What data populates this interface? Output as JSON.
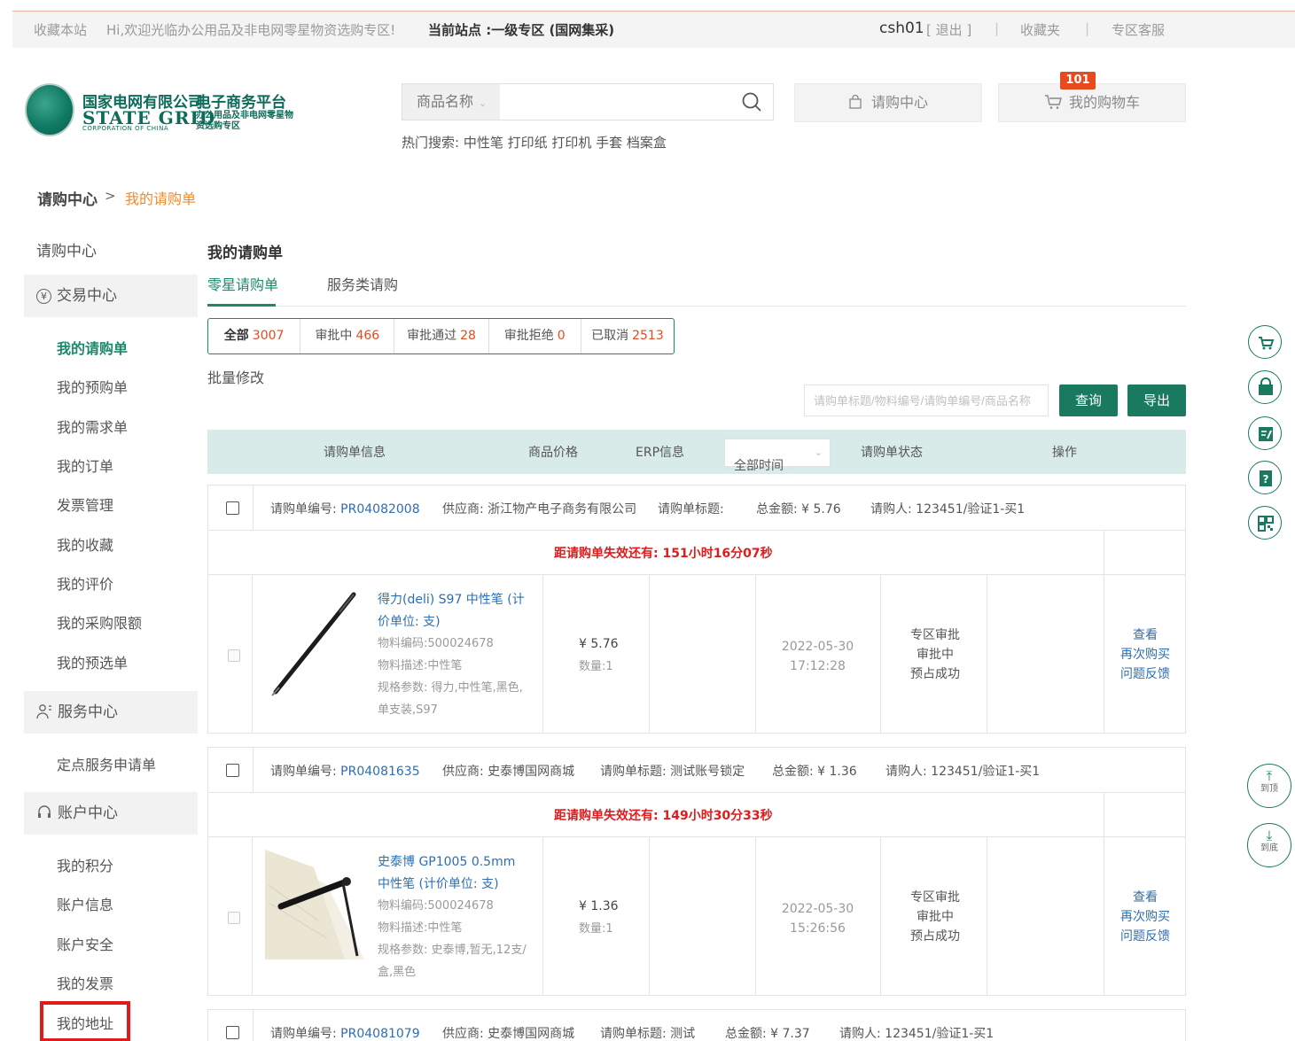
{
  "topbar": {
    "bookmark": "收藏本站",
    "welcome": "Hi,欢迎光临办公用品及非电网零星物资选购专区!",
    "current_site": "当前站点 :一级专区 (国网集采)",
    "username": "csh01",
    "logout": "[ 退出 ]",
    "favorites": "收藏夹",
    "service": "专区客服"
  },
  "logo": {
    "cn_name": "国家电网有限公司",
    "platform": "电子商务平台",
    "en_name": "STATE GRID",
    "en_sub": "CORPORATION OF CHINA",
    "sub": "办公用品及非电网零星物资选购专区"
  },
  "search": {
    "category": "商品名称",
    "value": "",
    "hot_label": "热门搜索:",
    "hot_terms": "中性笔 打印纸 打印机 手套 档案盒"
  },
  "header_buttons": {
    "purchase_center": "请购中心",
    "cart": "我的购物车",
    "cart_count": "101"
  },
  "breadcrumb": {
    "root": "请购中心",
    "sep": ">",
    "current": "我的请购单"
  },
  "sidebar": {
    "purchase_center": "请购中心",
    "trade_center": "交易中心",
    "trade_items": [
      "我的请购单",
      "我的预购单",
      "我的需求单",
      "我的订单",
      "发票管理",
      "我的收藏",
      "我的评价",
      "我的采购限额",
      "我的预选单"
    ],
    "service_center": "服务中心",
    "service_items": [
      "定点服务申请单"
    ],
    "account_center": "账户中心",
    "account_items": [
      "我的积分",
      "账户信息",
      "账户安全",
      "我的发票",
      "我的地址"
    ]
  },
  "main": {
    "title": "我的请购单",
    "tabs": [
      "零星请购单",
      "服务类请购"
    ],
    "status_tabs": [
      {
        "label": "全部",
        "count": "3007"
      },
      {
        "label": "审批中",
        "count": "466"
      },
      {
        "label": "审批通过",
        "count": "28"
      },
      {
        "label": "审批拒绝",
        "count": "0"
      },
      {
        "label": "已取消",
        "count": "2513"
      }
    ],
    "bulk_edit": "批量修改",
    "search_placeholder": "请购单标题/物料编号/请购单编号/商品名称",
    "query": "查询",
    "export": "导出"
  },
  "table_header": {
    "info": "请购单信息",
    "price": "商品价格",
    "erp": "ERP信息",
    "time_filter": "全部时间",
    "status": "请购单状态",
    "ops": "操作"
  },
  "orders": [
    {
      "no_label": "请购单编号:",
      "no": "PR04082008",
      "supplier": "供应商: 浙江物产电子商务有限公司",
      "title": "请购单标题:",
      "total": "总金额: ¥ 5.76",
      "buyer": "请购人: 123451/验证1-买1",
      "timer": "距请购单失效还有: 151小时16分07秒",
      "product": "得力(deli) S97 中性笔 (计价单位: 支)",
      "code": "物料编码:500024678",
      "desc": "物料描述:中性笔",
      "spec": "规格参数: 得力,中性笔,黑色,单支装,S97",
      "price": "¥ 5.76",
      "qty": "数量:1",
      "date": "2022-05-30",
      "time": "17:12:28",
      "status1": "专区审批",
      "status2": "审批中",
      "status3": "预占成功",
      "op1": "查看",
      "op2": "再次购买",
      "op3": "问题反馈"
    },
    {
      "no_label": "请购单编号:",
      "no": "PR04081635",
      "supplier": "供应商: 史泰博国网商城",
      "title": "请购单标题: 测试账号锁定",
      "total": "总金额: ¥ 1.36",
      "buyer": "请购人: 123451/验证1-买1",
      "timer": "距请购单失效还有: 149小时30分33秒",
      "product": "史泰博 GP1005 0.5mm 中性笔 (计价单位: 支)",
      "code": "物料编码:500024678",
      "desc": "物料描述:中性笔",
      "spec": "规格参数: 史泰博,暂无,12支/盒,黑色",
      "price": "¥ 1.36",
      "qty": "数量:1",
      "date": "2022-05-30",
      "time": "15:26:56",
      "status1": "专区审批",
      "status2": "审批中",
      "status3": "预占成功",
      "op1": "查看",
      "op2": "再次购买",
      "op3": "问题反馈"
    },
    {
      "no_label": "请购单编号:",
      "no": "PR04081079",
      "supplier": "供应商: 史泰博国网商城",
      "title": "请购单标题: 测试",
      "total": "总金额: ¥ 7.37",
      "buyer": "请购人: 123451/验证1-买1"
    }
  ],
  "float_nav": {
    "top": "到顶",
    "bottom": "到底"
  },
  "colors": {
    "brand_green": "#1a7a60",
    "accent_orange": "#f08c2a",
    "alert_red": "#e01b1b",
    "link_blue": "#2c6fb5"
  }
}
